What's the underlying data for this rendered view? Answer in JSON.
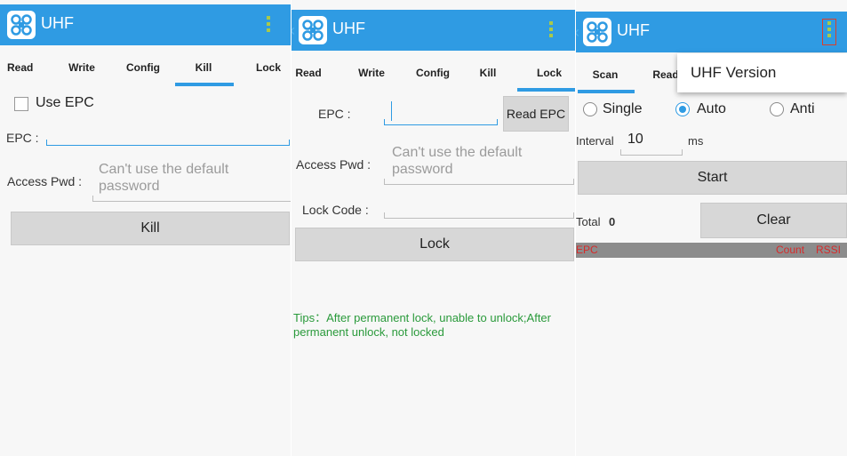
{
  "app": {
    "title": "UHF"
  },
  "colors": {
    "accent": "#2f9be3",
    "tips": "#2a9a3b",
    "list_header_text": "#d62b2b"
  },
  "icons": {
    "logo": "uhf-logo-icon",
    "overflow": "overflow-menu-icon",
    "back": "back-icon"
  },
  "kill_screen": {
    "tabs": [
      "Read",
      "Write",
      "Config",
      "Kill",
      "Lock"
    ],
    "selected_tab": "Kill",
    "use_epc_label": "Use EPC",
    "epc_label": "EPC :",
    "access_pwd_label": "Access Pwd :",
    "access_pwd_placeholder": "Can't use the default password",
    "kill_button": "Kill"
  },
  "lock_screen": {
    "tabs": [
      "Read",
      "Write",
      "Config",
      "Kill",
      "Lock"
    ],
    "selected_tab": "Lock",
    "epc_label": "EPC :",
    "read_epc_button": "Read EPC",
    "access_pwd_label": "Access Pwd :",
    "access_pwd_placeholder": "Can't use the default password",
    "lock_code_label": "Lock Code :",
    "lock_button": "Lock",
    "tips": "Tips：After permanent lock, unable to unlock;After permanent unlock, not locked"
  },
  "scan_screen": {
    "tabs": [
      "Scan",
      "Read"
    ],
    "selected_tab": "Scan",
    "menu_item": "UHF Version",
    "radio": {
      "single": "Single",
      "auto": "Auto",
      "anti": "Anti",
      "selected": "Auto"
    },
    "interval_label": "Interval",
    "interval_value": "10",
    "interval_unit": "ms",
    "start_button": "Start",
    "total_label": "Total",
    "total_value": "0",
    "clear_button": "Clear",
    "list_header": {
      "epc": "EPC",
      "count": "Count",
      "rssi": "RSSI"
    }
  }
}
